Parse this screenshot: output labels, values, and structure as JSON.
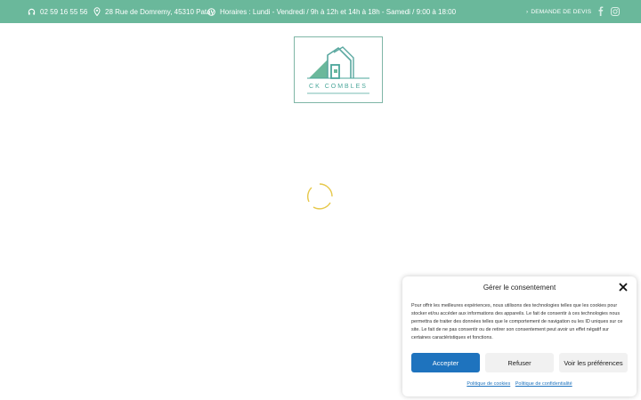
{
  "topbar": {
    "phone": "02 59 16 55 56",
    "address": "28 Rue de Domremy, 45310 Patay",
    "hours": "Horaires : Lundi - Vendredi / 9h à 12h et 14h à 18h - Samedi / 9:00 à 18:00",
    "devis_label": "DEMANDE DE DEVIS",
    "social": [
      "facebook-icon",
      "instagram-icon"
    ]
  },
  "logo": {
    "text": "CK COMBLES"
  },
  "colors": {
    "topbar": "#6ab89b",
    "accent": "#1e73be",
    "logo": "#4aa69a",
    "spinner": "#e6c84a"
  },
  "consent": {
    "title": "Gérer le consentement",
    "text": "Pour offrir les meilleures expériences, nous utilisons des technologies telles que les cookies pour stocker et/ou accéder aux informations des appareils. Le fait de consentir à ces technologies nous permettra de traiter des données telles que le comportement de navigation ou les ID uniques sur ce site. Le fait de ne pas consentir ou de retirer son consentement peut avoir un effet négatif sur certaines caractéristiques et fonctions.",
    "accept": "Accepter",
    "refuse": "Refuser",
    "preferences": "Voir les préférences",
    "cookie_policy": "Politique de cookies",
    "privacy_policy": "Politique de confidentialité"
  }
}
